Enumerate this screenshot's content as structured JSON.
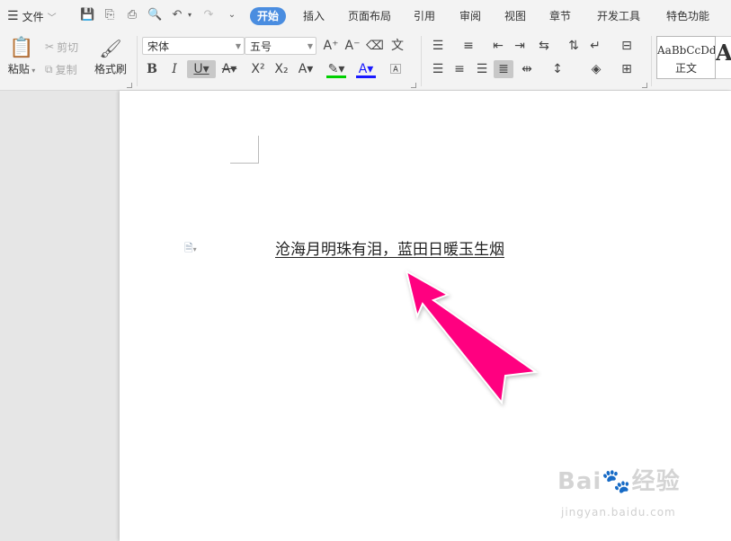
{
  "menu": {
    "file_label": "文件"
  },
  "tabs": [
    "开始",
    "插入",
    "页面布局",
    "引用",
    "审阅",
    "视图",
    "章节",
    "开发工具",
    "特色功能"
  ],
  "clipboard": {
    "paste": "粘贴",
    "cut": "剪切",
    "copy": "复制",
    "format_painter": "格式刷"
  },
  "font": {
    "name": "宋体",
    "size": "五号"
  },
  "styles": {
    "sample": "AaBbCcDd",
    "normal": "正文",
    "heading_sample": "A"
  },
  "document": {
    "text": "沧海月明珠有泪，蓝田日暖玉生烟"
  },
  "watermark": {
    "brand": "Bai🐾经验",
    "url": "jingyan.baidu.com"
  },
  "colors": {
    "accent": "#4a8de0",
    "annotation_arrow": "#ff0080",
    "highlight": "#00d000",
    "font_color": "#1a1aff"
  }
}
